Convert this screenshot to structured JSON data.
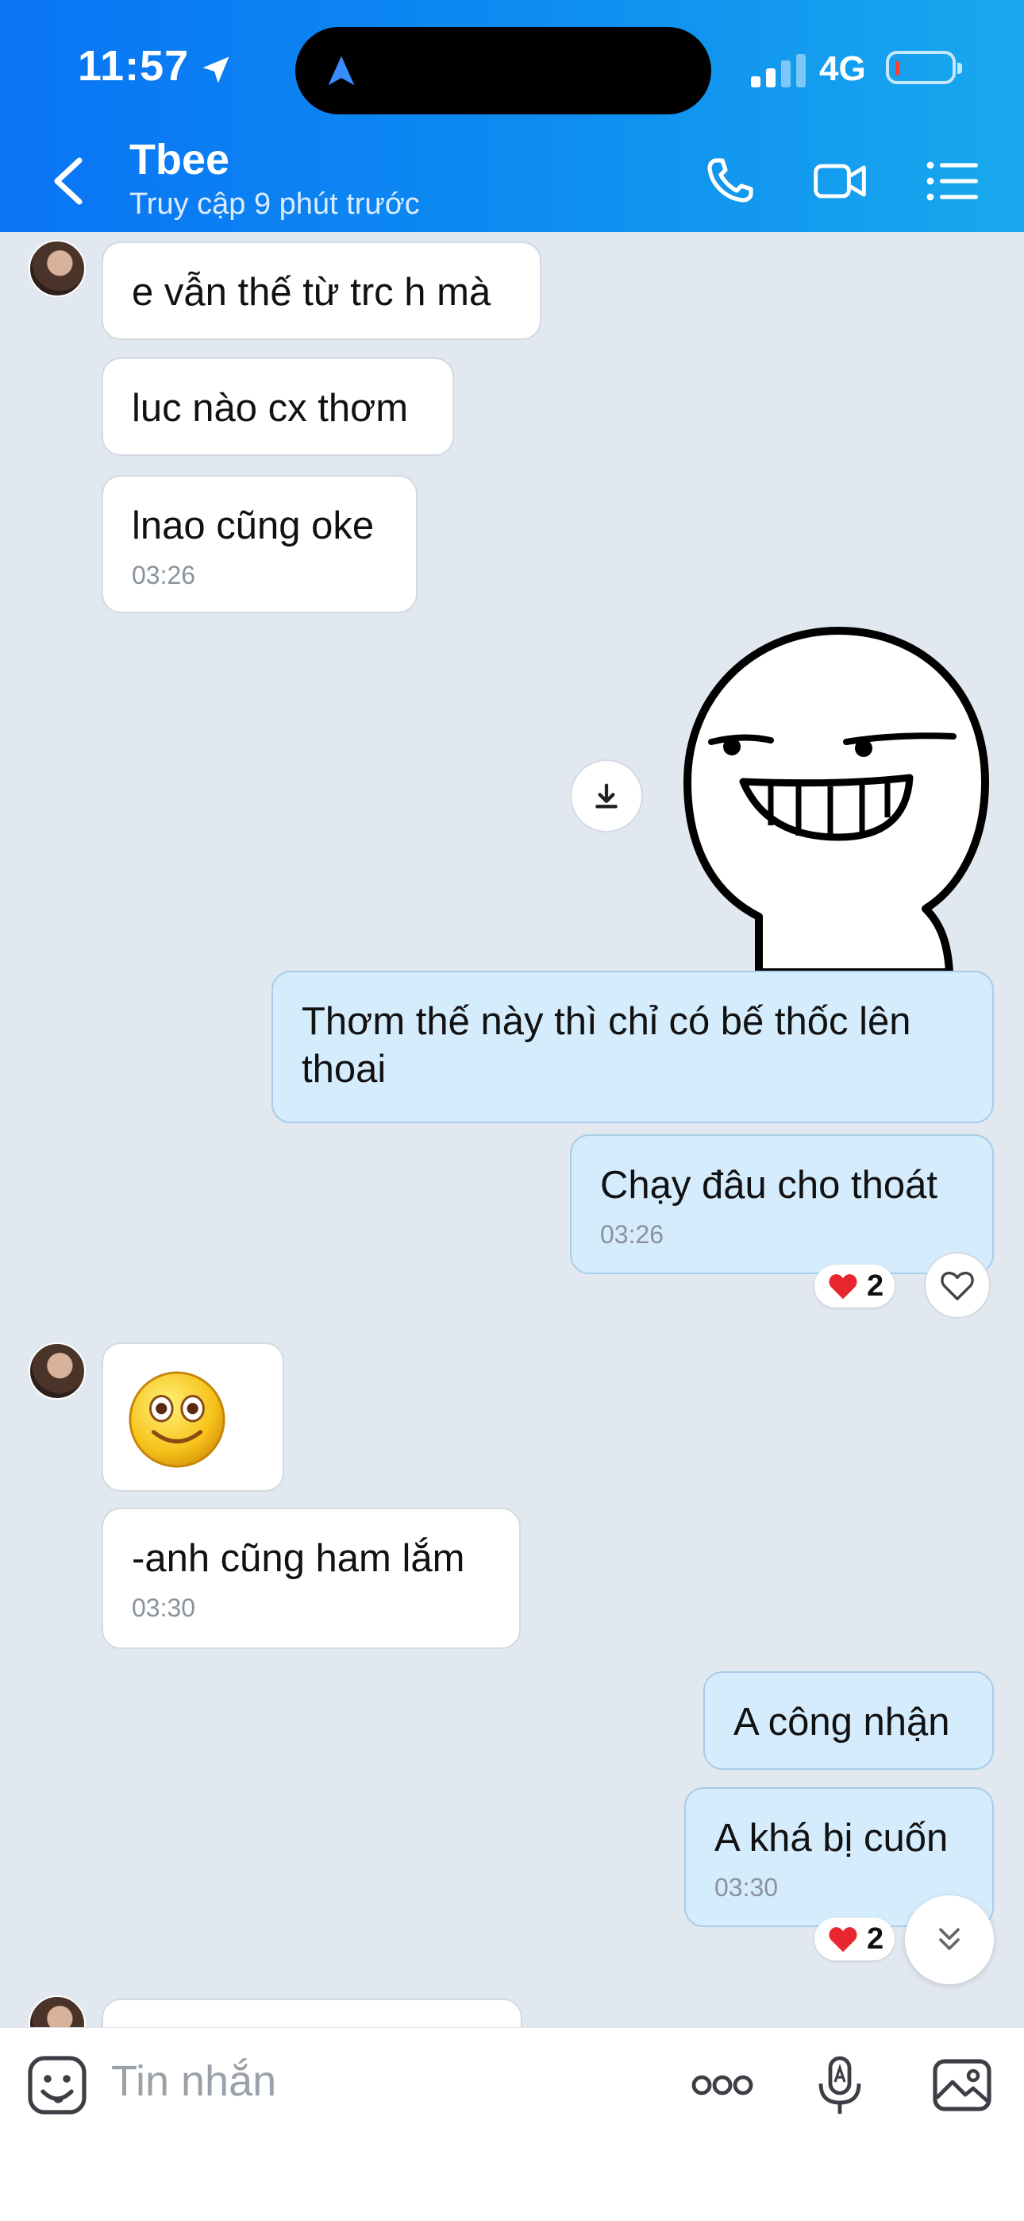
{
  "status_bar": {
    "time": "11:57",
    "network": "4G"
  },
  "header": {
    "contact_name": "Tbee",
    "contact_status": "Truy cập 9 phút trước"
  },
  "messages": [
    {
      "text": "e vẫn thế từ trc h mà"
    },
    {
      "text": "luc nào cx thơm"
    },
    {
      "text": "lnao cũng oke",
      "time": "03:26"
    },
    {
      "text": "Thơm thế này thì chỉ có bế thốc lên thoai"
    },
    {
      "text": "Chạy đâu cho thoát",
      "time": "03:26",
      "reaction_count": "2"
    },
    {
      "text": "-anh cũng ham lắm",
      "time": "03:30"
    },
    {
      "text": "A công nhận"
    },
    {
      "text": "A khá bị cuốn",
      "time": "03:30",
      "reaction_count": "2"
    }
  ],
  "input": {
    "placeholder": "Tin nhắn"
  },
  "icons": {
    "header": [
      "back-icon",
      "phone-icon",
      "video-icon",
      "menu-icon"
    ],
    "chat": [
      "download-icon",
      "heart-icon",
      "chevron-double-down-icon",
      "smiley-emoji-icon",
      "sticker-face"
    ],
    "input_bar": [
      "sticker-icon",
      "more-icon",
      "voice-icon",
      "image-icon"
    ]
  },
  "colors": {
    "header_start": "#0a74f5",
    "header_end": "#19a8ee",
    "outgoing_bubble": "#d5ecfd",
    "incoming_bubble": "#ffffff",
    "chat_background": "#e2e8f0",
    "heart": "#e8262f"
  }
}
